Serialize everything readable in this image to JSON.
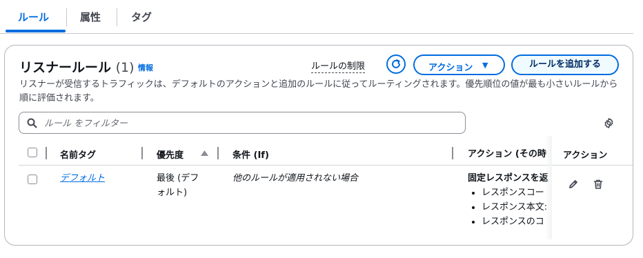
{
  "tabs": [
    {
      "label": "ルール",
      "active": true
    },
    {
      "label": "属性",
      "active": false
    },
    {
      "label": "タグ",
      "active": false
    }
  ],
  "panel": {
    "title": "リスナールール",
    "count": "(1)",
    "info_link": "情報",
    "limits_link": "ルールの制限",
    "action_button": "アクション",
    "add_rule_button": "ルールを追加する",
    "description": "リスナーが受信するトラフィックは、デフォルトのアクションと追加のルールに従ってルーティングされます。優先順位の値が最も小さいルールから順に評価されます。"
  },
  "filter": {
    "placeholder": "ルール をフィルター"
  },
  "table": {
    "columns": [
      "名前タグ",
      "優先度",
      "条件 (If)",
      "アクション (その時",
      "アクション"
    ],
    "sorted_column": "優先度",
    "rows": [
      {
        "name": "デフォルト",
        "priority": "最後 (デフォルト)",
        "priority_line1": "最後 (デフ",
        "priority_line2": "ォルト)",
        "condition": "他のルールが適用されない場合",
        "action_title": "固定レスポンスを返",
        "action_items": [
          "レスポンスコー",
          "レスポンス本文:",
          "レスポンスのコ"
        ]
      }
    ]
  },
  "colors": {
    "accent": "#006ce0",
    "text": "#0f141a",
    "secondary": "#424650",
    "border": "#b4b4bb"
  },
  "icons": [
    "refresh-icon",
    "caret-down-icon",
    "search-icon",
    "gear-icon",
    "edit-icon",
    "delete-icon"
  ]
}
